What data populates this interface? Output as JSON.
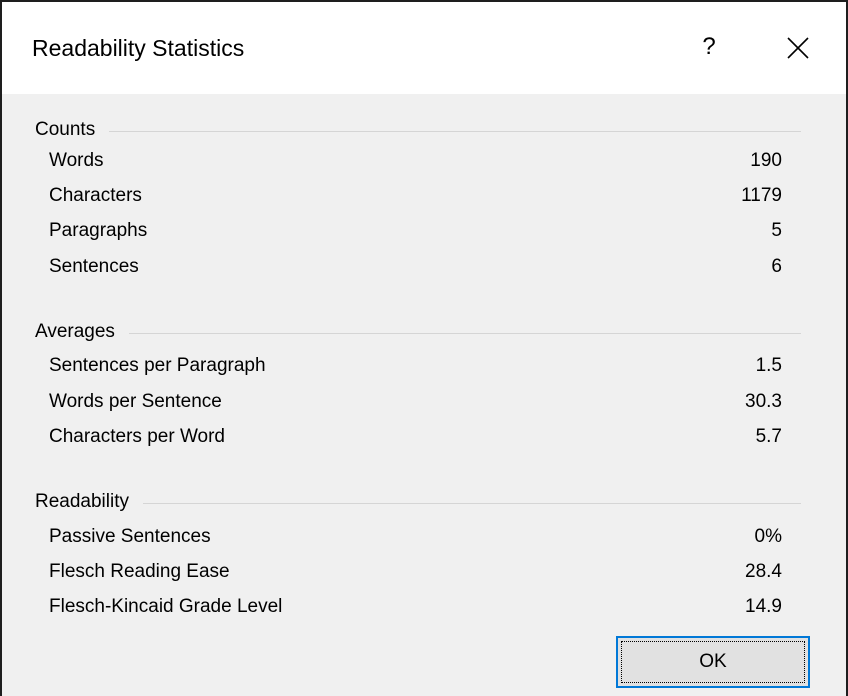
{
  "dialog": {
    "title": "Readability Statistics",
    "help_label": "?",
    "ok_label": "OK"
  },
  "sections": {
    "counts": {
      "label": "Counts",
      "rows": [
        {
          "label": "Words",
          "value": "190"
        },
        {
          "label": "Characters",
          "value": "1179"
        },
        {
          "label": "Paragraphs",
          "value": "5"
        },
        {
          "label": "Sentences",
          "value": "6"
        }
      ]
    },
    "averages": {
      "label": "Averages",
      "rows": [
        {
          "label": "Sentences per Paragraph",
          "value": "1.5"
        },
        {
          "label": "Words per Sentence",
          "value": "30.3"
        },
        {
          "label": "Characters per Word",
          "value": "5.7"
        }
      ]
    },
    "readability": {
      "label": "Readability",
      "rows": [
        {
          "label": "Passive Sentences",
          "value": "0%"
        },
        {
          "label": "Flesch Reading Ease",
          "value": "28.4"
        },
        {
          "label": "Flesch-Kincaid Grade Level",
          "value": "14.9"
        }
      ]
    }
  },
  "icons": {
    "close": "close-icon"
  },
  "colors": {
    "dialog_background": "#f0f0f0",
    "titlebar_background": "#ffffff",
    "focus_border": "#0078d7"
  }
}
